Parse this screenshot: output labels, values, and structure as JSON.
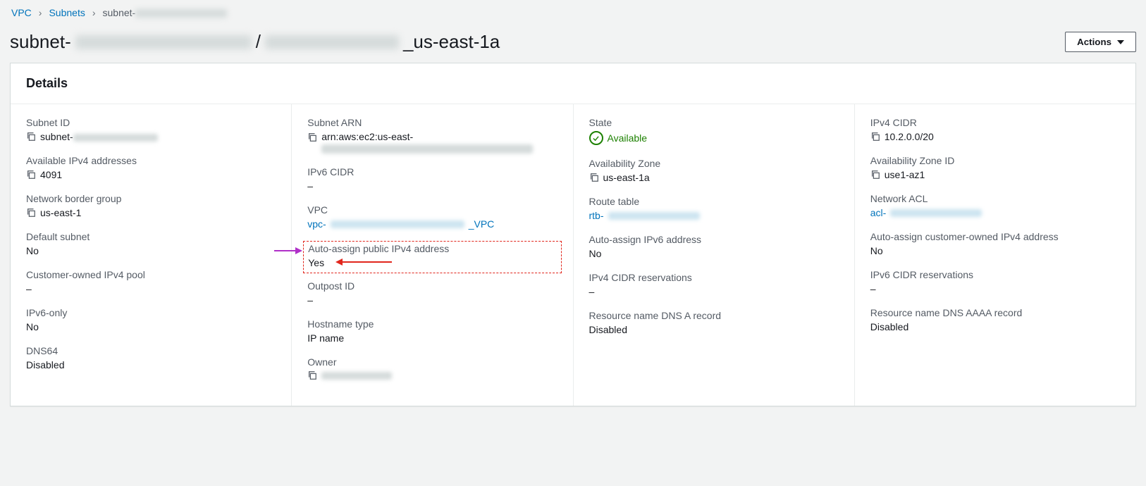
{
  "breadcrumbs": {
    "root": "VPC",
    "subnets": "Subnets",
    "current_prefix": "subnet-"
  },
  "header": {
    "title_prefix": "subnet-",
    "title_suffix": "_us-east-1a",
    "slash": " / ",
    "actions": "Actions"
  },
  "panel": {
    "title": "Details"
  },
  "col1": {
    "subnet_id": {
      "label": "Subnet ID",
      "value_prefix": "subnet-"
    },
    "avail_ipv4": {
      "label": "Available IPv4 addresses",
      "value": "4091"
    },
    "nbg": {
      "label": "Network border group",
      "value": "us-east-1"
    },
    "default_subnet": {
      "label": "Default subnet",
      "value": "No"
    },
    "cust_pool": {
      "label": "Customer-owned IPv4 pool",
      "value": "–"
    },
    "ipv6_only": {
      "label": "IPv6-only",
      "value": "No"
    },
    "dns64": {
      "label": "DNS64",
      "value": "Disabled"
    }
  },
  "col2": {
    "arn": {
      "label": "Subnet ARN",
      "value_prefix": "arn:aws:ec2:us-east-"
    },
    "ipv6_cidr": {
      "label": "IPv6 CIDR",
      "value": "–"
    },
    "vpc": {
      "label": "VPC",
      "link_prefix": "vpc-",
      "link_suffix": "_VPC"
    },
    "auto_v4": {
      "label": "Auto-assign public IPv4 address",
      "value": "Yes"
    },
    "outpost": {
      "label": "Outpost ID",
      "value": "–"
    },
    "hostname": {
      "label": "Hostname type",
      "value": "IP name"
    },
    "owner": {
      "label": "Owner"
    }
  },
  "col3": {
    "state": {
      "label": "State",
      "value": "Available"
    },
    "az": {
      "label": "Availability Zone",
      "value": "us-east-1a"
    },
    "rtb": {
      "label": "Route table",
      "link_prefix": "rtb-"
    },
    "auto_v6": {
      "label": "Auto-assign IPv6 address",
      "value": "No"
    },
    "v4_res": {
      "label": "IPv4 CIDR reservations",
      "value": "–"
    },
    "dns_a": {
      "label": "Resource name DNS A record",
      "value": "Disabled"
    }
  },
  "col4": {
    "v4cidr": {
      "label": "IPv4 CIDR",
      "value": "10.2.0.0/20"
    },
    "az_id": {
      "label": "Availability Zone ID",
      "value": "use1-az1"
    },
    "acl": {
      "label": "Network ACL",
      "link_prefix": "acl-"
    },
    "auto_cust": {
      "label": "Auto-assign customer-owned IPv4 address",
      "value": "No"
    },
    "v6_res": {
      "label": "IPv6 CIDR reservations",
      "value": "–"
    },
    "dns_aaaa": {
      "label": "Resource name DNS AAAA record",
      "value": "Disabled"
    }
  }
}
